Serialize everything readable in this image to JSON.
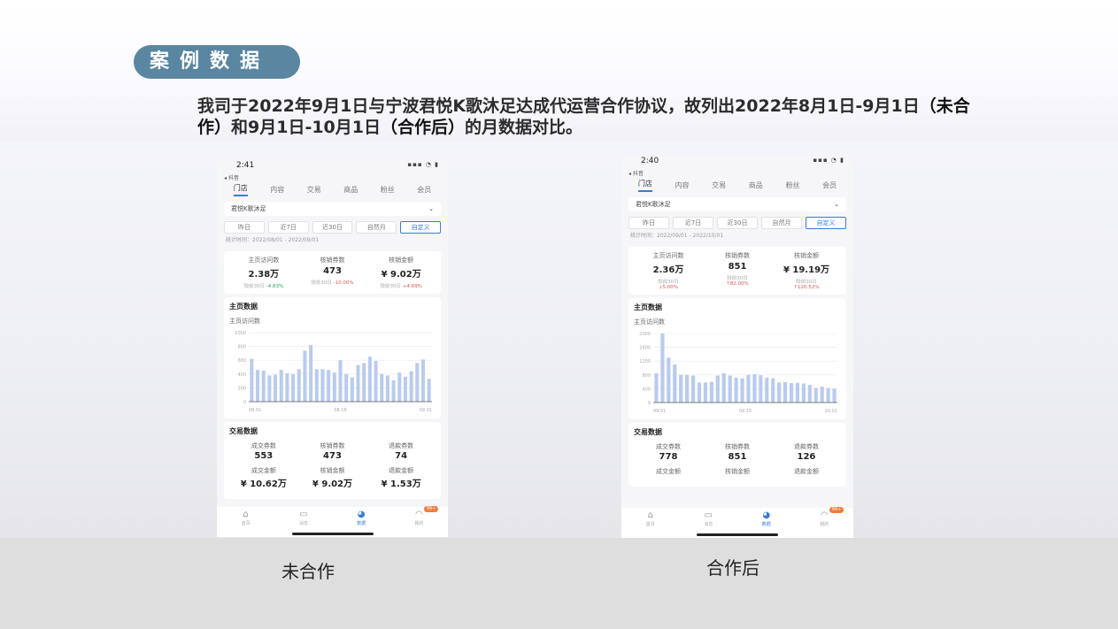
{
  "badge": {
    "label": "案例数据"
  },
  "intro": {
    "part1": "我司于2022年9月1日与宁波君悦K歌沐足达成代运营合作协议，故列出2022年8月1日-9月1日",
    "bold1": "（未合作）",
    "part2": "和9月1日-10月1日",
    "bold2": "（合作后）",
    "part3": "的月数据对比。"
  },
  "captions": {
    "left": "未合作",
    "right": "合作后"
  },
  "colors": {
    "badge": "#5a86a2",
    "bar": "#b9cbee",
    "accent": "#3b7bd8",
    "badge_notice": "#f27b3a"
  },
  "left_phone": {
    "time": "2:41",
    "back": "◂ 抖音",
    "tabs": [
      "门店",
      "内容",
      "交易",
      "商品",
      "粉丝",
      "会员"
    ],
    "store": "君悦K歌沐足",
    "ranges": [
      "昨日",
      "近7日",
      "近30日",
      "自然月",
      "自定义"
    ],
    "date_line": "统计时间：2022/08/01 - 2022/09/01",
    "kpis": [
      {
        "label": "主页访问数",
        "value": "2.38万",
        "cmp": "较前30日",
        "delta": "-4.83%",
        "dir": "up"
      },
      {
        "label": "核销券数",
        "value": "473",
        "cmp": "较前30日",
        "delta": "-10.00%",
        "dir": "dn"
      },
      {
        "label": "核销金额",
        "value": "¥ 9.02万",
        "cmp": "较前30日",
        "delta": "+4.69%",
        "dir": "dn"
      }
    ],
    "home_section": "主页数据",
    "chart_sub": "主页访问数",
    "trade_section": "交易数据",
    "trade": [
      {
        "label": "成交券数",
        "value": "553"
      },
      {
        "label": "核销券数",
        "value": "473"
      },
      {
        "label": "退款券数",
        "value": "74"
      },
      {
        "label": "成交金额",
        "value": "¥ 10.62万"
      },
      {
        "label": "核销金额",
        "value": "¥ 9.02万"
      },
      {
        "label": "退款金额",
        "value": "¥ 1.53万"
      }
    ],
    "nav": [
      "首页",
      "消息",
      "数据",
      "我的"
    ],
    "nav_pill": "99+"
  },
  "right_phone": {
    "time": "2:40",
    "back": "◂ 抖音",
    "tabs": [
      "门店",
      "内容",
      "交易",
      "商品",
      "粉丝",
      "会员"
    ],
    "store": "君悦K歌沐足",
    "ranges": [
      "昨日",
      "近7日",
      "近30日",
      "自然月",
      "自定义"
    ],
    "date_line": "统计时间：2022/09/01 - 2022/10/01",
    "kpis": [
      {
        "label": "主页访问数",
        "value": "2.36万",
        "cmp": "较前30日",
        "delta": "↓5.00%",
        "dir": "dn"
      },
      {
        "label": "核销券数",
        "value": "851",
        "cmp": "较前30日",
        "delta": "↑82.00%",
        "dir": "dn"
      },
      {
        "label": "核销金额",
        "value": "¥ 19.19万",
        "cmp": "较前30日",
        "delta": "↑120.52%",
        "dir": "dn"
      }
    ],
    "home_section": "主页数据",
    "chart_sub": "主页访问数",
    "trade_section": "交易数据",
    "trade": [
      {
        "label": "成交券数",
        "value": "778"
      },
      {
        "label": "核销券数",
        "value": "851"
      },
      {
        "label": "退款券数",
        "value": "126"
      },
      {
        "label": "成交金额",
        "value": ""
      },
      {
        "label": "核销金额",
        "value": ""
      },
      {
        "label": "退款金额",
        "value": ""
      }
    ],
    "nav": [
      "首页",
      "消息",
      "数据",
      "我的"
    ],
    "nav_pill": "99+"
  },
  "chart_data": [
    {
      "type": "bar",
      "x": [
        "08.01",
        "08.02",
        "08.03",
        "08.04",
        "08.05",
        "08.06",
        "08.07",
        "08.08",
        "08.09",
        "08.10",
        "08.11",
        "08.12",
        "08.13",
        "08.14",
        "08.15",
        "08.16",
        "08.17",
        "08.18",
        "08.19",
        "08.20",
        "08.21",
        "08.22",
        "08.23",
        "08.24",
        "08.25",
        "08.26",
        "08.27",
        "08.28",
        "08.29",
        "08.30",
        "08.31"
      ],
      "x_tick_labels": [
        "08.01",
        "08.16",
        "09.01"
      ],
      "y_tick_labels": [
        "1000",
        "800",
        "600",
        "400",
        "200",
        "0"
      ],
      "values": [
        620,
        460,
        450,
        380,
        390,
        460,
        410,
        400,
        470,
        740,
        820,
        470,
        470,
        460,
        420,
        600,
        400,
        350,
        530,
        560,
        650,
        590,
        400,
        380,
        310,
        420,
        360,
        440,
        560,
        610,
        330
      ],
      "ylim": [
        0,
        1000
      ]
    },
    {
      "type": "bar",
      "x": [
        "09.01",
        "09.02",
        "09.03",
        "09.04",
        "09.05",
        "09.06",
        "09.07",
        "09.08",
        "09.09",
        "09.10",
        "09.11",
        "09.12",
        "09.13",
        "09.14",
        "09.15",
        "09.16",
        "09.17",
        "09.18",
        "09.19",
        "09.20",
        "09.21",
        "09.22",
        "09.23",
        "09.24",
        "09.25",
        "09.26",
        "09.27",
        "09.28",
        "09.29",
        "09.30"
      ],
      "x_tick_labels": [
        "09.01",
        "09.15",
        "10.01"
      ],
      "y_tick_labels": [
        "2000",
        "1600",
        "1200",
        "800",
        "400",
        "0"
      ],
      "values": [
        850,
        2000,
        1300,
        1100,
        800,
        800,
        780,
        580,
        580,
        600,
        780,
        850,
        780,
        720,
        700,
        800,
        820,
        790,
        720,
        700,
        580,
        590,
        560,
        570,
        550,
        510,
        420,
        460,
        420,
        400
      ],
      "ylim": [
        0,
        2000
      ]
    }
  ]
}
